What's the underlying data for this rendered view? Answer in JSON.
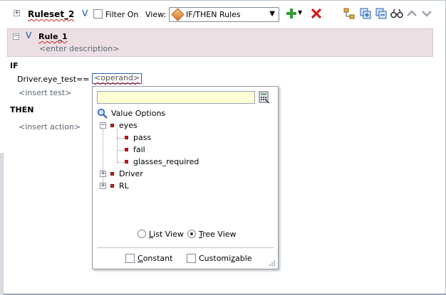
{
  "toolbar": {
    "ruleset_name": "Ruleset_2",
    "filter_label": "Filter On",
    "view_label": "View:",
    "view_select_value": "IF/THEN Rules"
  },
  "rule": {
    "name": "Rule_1",
    "description_placeholder": "<enter description>"
  },
  "body": {
    "if_label": "IF",
    "test_left": "Driver.eye_test",
    "test_operator": "==",
    "operand_placeholder": "<operand>",
    "insert_test": "<insert test>",
    "then_label": "THEN",
    "insert_action": "<insert action>"
  },
  "popup": {
    "search_value": "",
    "value_options_label": "Value Options",
    "tree": {
      "eyes": {
        "label": "eyes",
        "children": [
          "pass",
          "fail",
          "glasses_required"
        ]
      },
      "driver": {
        "label": "Driver"
      },
      "rl": {
        "label": "RL"
      }
    },
    "list_view_label": "List View",
    "tree_view_label": "Tree View",
    "selected_view": "tree",
    "constant_label": "Constant",
    "customizable_label": "Customizable"
  },
  "colors": {
    "rule_header_bg": "#ecdfe4",
    "accent": "#2a5fb0",
    "input_bg": "#ffffd6",
    "leaf_marker": "#d21b1b"
  }
}
